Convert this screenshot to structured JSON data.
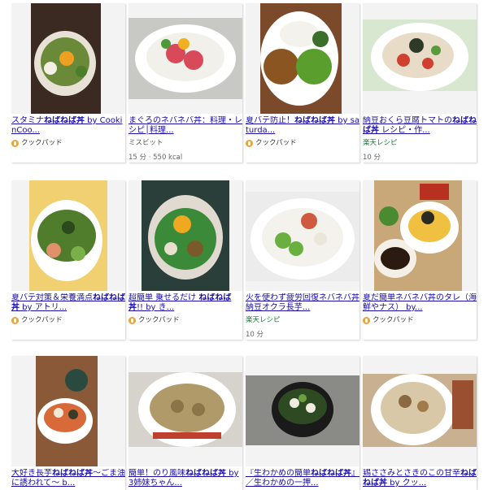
{
  "cards": [
    {
      "title_pre": "スタミナ",
      "title_bold": "ねばねば丼",
      "title_post": " by CookinCoo...",
      "source": "クックパッド",
      "meta": ""
    },
    {
      "title_pre": "まぐろのネバネバ丼：料理・レシピ│料理...",
      "title_bold": "",
      "title_post": "",
      "source": "ミスビット",
      "meta": "15 分 · 550 kcal"
    },
    {
      "title_pre": "夏バテ防止！",
      "title_bold": "ねばねば丼",
      "title_post": " by saturda...",
      "source": "クックパッド",
      "meta": ""
    },
    {
      "title_pre": "納豆おくら豆腐トマトの",
      "title_bold": "ねばねば丼",
      "title_post": " レシピ・作...",
      "source": "楽天レシピ",
      "meta": "10 分"
    },
    {
      "title_pre": "夏バテ対策＆栄養満点",
      "title_bold": "ねばねば丼",
      "title_post": " by アトリ...",
      "source": "クックパッド",
      "meta": ""
    },
    {
      "title_pre": "超簡単 乗せるだけ ",
      "title_bold": "ねばねば丼",
      "title_post": "!! by き...",
      "source": "クックパッド",
      "meta": ""
    },
    {
      "title_pre": "火を使わず疲労回復ネバネバ丼 納豆オクラ長芋...",
      "title_bold": "",
      "title_post": "",
      "source": "楽天レシピ",
      "meta": "10 分"
    },
    {
      "title_pre": "夏だ簡単ネバネバ丼のタレ（海鮮やナス） by...",
      "title_bold": "",
      "title_post": "",
      "source": "クックパッド",
      "meta": ""
    },
    {
      "title_pre": "大好き長芋",
      "title_bold": "ねばねば丼",
      "title_post": "〜ごま油に誘われて〜 b...",
      "source": "",
      "meta": ""
    },
    {
      "title_pre": "簡単！のり風味",
      "title_bold": "ねばねば丼",
      "title_post": " by 3姉妹ちゃん...",
      "source": "",
      "meta": ""
    },
    {
      "title_pre": "『生わかめの簡単",
      "title_bold": "ねばねば丼",
      "title_post": "』／生わかめの一押...",
      "source": "",
      "meta": ""
    },
    {
      "title_pre": "鶏ささみとさきのこの甘辛",
      "title_bold": "ねばねば丼",
      "title_post": " by クッ...",
      "source": "",
      "meta": ""
    }
  ],
  "icons": {
    "cookpad": "cookpad-icon"
  },
  "colors": {
    "link": "#1a0dab",
    "source": "#137333",
    "meta": "#666666"
  }
}
